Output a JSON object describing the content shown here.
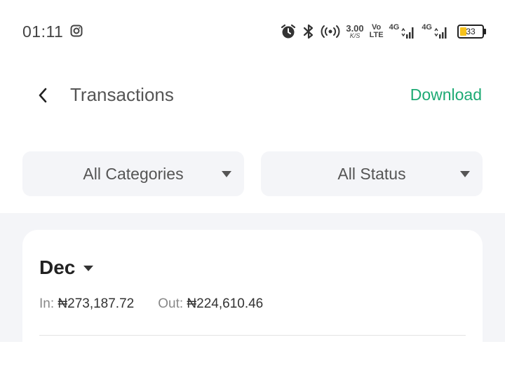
{
  "status_bar": {
    "time": "01:11",
    "speed_value": "3.00",
    "speed_unit": "K/S",
    "volte_top": "Vo",
    "volte_bottom": "LTE",
    "net1_label": "4G",
    "net2_label": "4G",
    "battery": "33",
    "icons": [
      "instagram-icon",
      "alarm-icon",
      "bluetooth-icon",
      "hotspot-icon",
      "signal-icon",
      "battery-icon"
    ]
  },
  "header": {
    "title": "Transactions",
    "download_label": "Download"
  },
  "filters": {
    "category": "All Categories",
    "status": "All Status"
  },
  "month_section": {
    "month": "Dec",
    "in_label": "In:",
    "in_value": "₦273,187.72",
    "out_label": "Out:",
    "out_value": "₦224,610.46"
  },
  "colors": {
    "accent": "#1daa74",
    "surface": "#f4f5f8",
    "battery": "#f6c21c"
  }
}
